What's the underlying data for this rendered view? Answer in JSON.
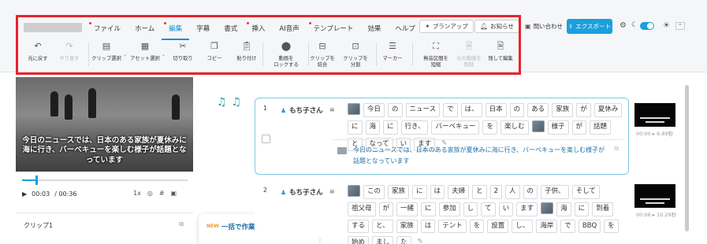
{
  "menu": {
    "tabs": [
      {
        "label": "ファイル",
        "dot": true
      },
      {
        "label": "ホーム",
        "dot": false
      },
      {
        "label": "編集",
        "dot": true
      },
      {
        "label": "字幕",
        "dot": false
      },
      {
        "label": "書式",
        "dot": false
      },
      {
        "label": "挿入",
        "dot": true
      },
      {
        "label": "AI音声",
        "dot": false
      },
      {
        "label": "テンプレート",
        "dot": true
      },
      {
        "label": "効果",
        "dot": false
      },
      {
        "label": "ヘルプ",
        "dot": false
      }
    ],
    "active_tab": "編集",
    "upgrade_label": "プランアップ",
    "notice_label": "お知らせ",
    "contact_label": "問い合わせ",
    "export_label": "エクスポート"
  },
  "toolbar": {
    "undo": "元に戻す",
    "redo": "やり直す",
    "clip_select": "クリップ選択",
    "asset_select": "アセット選択",
    "cut": "切り取り",
    "copy": "コピー",
    "paste": "貼り付け",
    "lock_video_1": "動画を",
    "lock_video_2": "ロックする",
    "merge_1": "クリップを",
    "merge_2": "結合",
    "split_1": "クリップを",
    "split_2": "分割",
    "marker": "マーカー",
    "silence_1": "無音区間を",
    "silence_2": "短縮",
    "delete_1": "元の動画を",
    "delete_2": "削除",
    "batch_edit": "残して編集"
  },
  "player": {
    "caption": "今日のニュースでは、日本のある家族が夏休みに海に行き、バーベキューを楽しむ様子が話題となっています",
    "current_time": "00:03",
    "total_time": "/ 00:36",
    "speed": "1x",
    "progress": 0.08
  },
  "clip_panel": {
    "title": "クリップ1"
  },
  "popup": {
    "badge": "NEW",
    "title": "一括で作業",
    "close": "×"
  },
  "segments": [
    {
      "number": "1",
      "speaker": "もち子さん",
      "tokens": [
        "[img]",
        "今日",
        "の",
        "ニュース",
        "で",
        "は、",
        "日本",
        "の",
        "ある",
        "家族",
        "が",
        "夏休み",
        "に",
        "海",
        "に",
        "行き、",
        "バーベキュー",
        "を",
        "楽しむ",
        "[img]",
        "様子",
        "が",
        "話題",
        "と",
        "なって",
        "い",
        "ます",
        "[pencil]"
      ],
      "summary": "今日のニュースでは、日本のある家族が夏休みに海に行き、バーベキューを楽しむ様子が話題となっています",
      "time": "00:00 ▸ 6.89秒"
    },
    {
      "number": "2",
      "speaker": "もち子さん",
      "tokens": [
        "[img]",
        "この",
        "家族",
        "に",
        "は",
        "夫婦",
        "と",
        "2",
        "人",
        "の",
        "子供、",
        "そして",
        "祖父母",
        "が",
        "一緒",
        "に",
        "参加",
        "し",
        "て",
        "い",
        "ます",
        "[img]",
        "海",
        "に",
        "到着",
        "する",
        "と、",
        "家族",
        "は",
        "テント",
        "を",
        "設置",
        "し、",
        "海岸",
        "で",
        "BBQ",
        "を",
        "始め",
        "まし",
        "た",
        "[pencil]"
      ],
      "time": "00:06 ▸ 10.29秒"
    }
  ],
  "colors": {
    "accent": "#1aa0dc",
    "highlight": "#e8232d",
    "summary_text": "#1d6fa5"
  }
}
